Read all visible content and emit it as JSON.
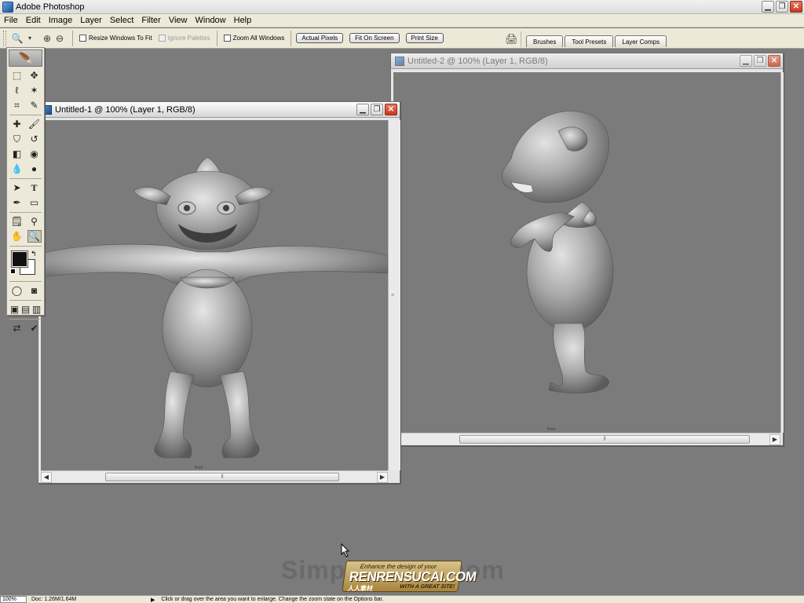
{
  "app": {
    "title": "Adobe Photoshop"
  },
  "menu": [
    "File",
    "Edit",
    "Image",
    "Layer",
    "Select",
    "Filter",
    "View",
    "Window",
    "Help"
  ],
  "options": {
    "resize_windows": "Resize Windows To Fit",
    "ignore_palettes": "Ignore Palettes",
    "zoom_all_windows": "Zoom All Windows",
    "actual_pixels": "Actual Pixels",
    "fit_on_screen": "Fit On Screen",
    "print_size": "Print Size"
  },
  "palette_well": {
    "tabs": [
      "Brushes",
      "Tool Presets",
      "Layer Comps"
    ]
  },
  "documents": [
    {
      "title": "Untitled-1 @ 100% (Layer 1, RGB/8)",
      "caption": "front",
      "active": true
    },
    {
      "title": "Untitled-2 @ 100% (Layer 1, RGB/8)",
      "caption": "front",
      "active": false
    }
  ],
  "watermark": {
    "site": "SimpleWorld.com",
    "badge_tagline": "Enhance the design of your",
    "badge_name": "RENRENSUCAI.COM",
    "badge_cn": "人人素材",
    "badge_slogan": "WITH A GREAT SITE!"
  },
  "status": {
    "zoom": "100%",
    "doc_size": "Doc: 1.26M/1.64M",
    "message": "Click or drag over the area you want to enlarge. Change the zoom state on the Options bar."
  },
  "colors": {
    "foreground": "#111111",
    "background": "#ffffff",
    "workspace": "#7b7b7b"
  }
}
